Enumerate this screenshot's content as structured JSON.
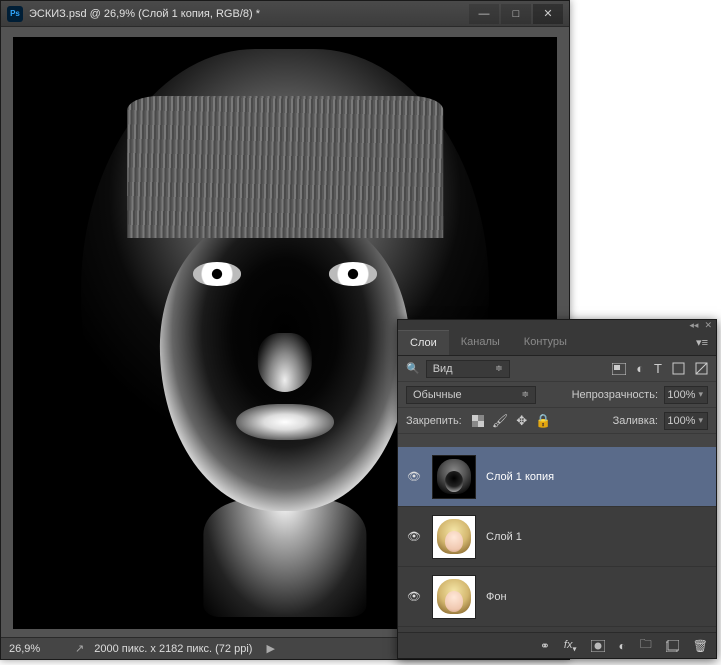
{
  "window": {
    "title": "ЭСКИЗ.psd @ 26,9% (Слой 1 копия, RGB/8) *",
    "minimize": "—",
    "maximize": "□",
    "close": "✕"
  },
  "status": {
    "zoom": "26,9%",
    "doc_info": "2000 пикс. x 2182 пикс. (72 ppi)"
  },
  "panel": {
    "tabs": {
      "layers": "Слои",
      "channels": "Каналы",
      "paths": "Контуры"
    },
    "filter": {
      "label": "Вид"
    },
    "blend_mode": "Обычные",
    "opacity": {
      "label": "Непрозрачность:",
      "value": "100%"
    },
    "lock": {
      "label": "Закрепить:"
    },
    "fill": {
      "label": "Заливка:",
      "value": "100%"
    },
    "layers_list": [
      {
        "name": "Слой 1 копия"
      },
      {
        "name": "Слой 1"
      },
      {
        "name": "Фон"
      }
    ]
  }
}
